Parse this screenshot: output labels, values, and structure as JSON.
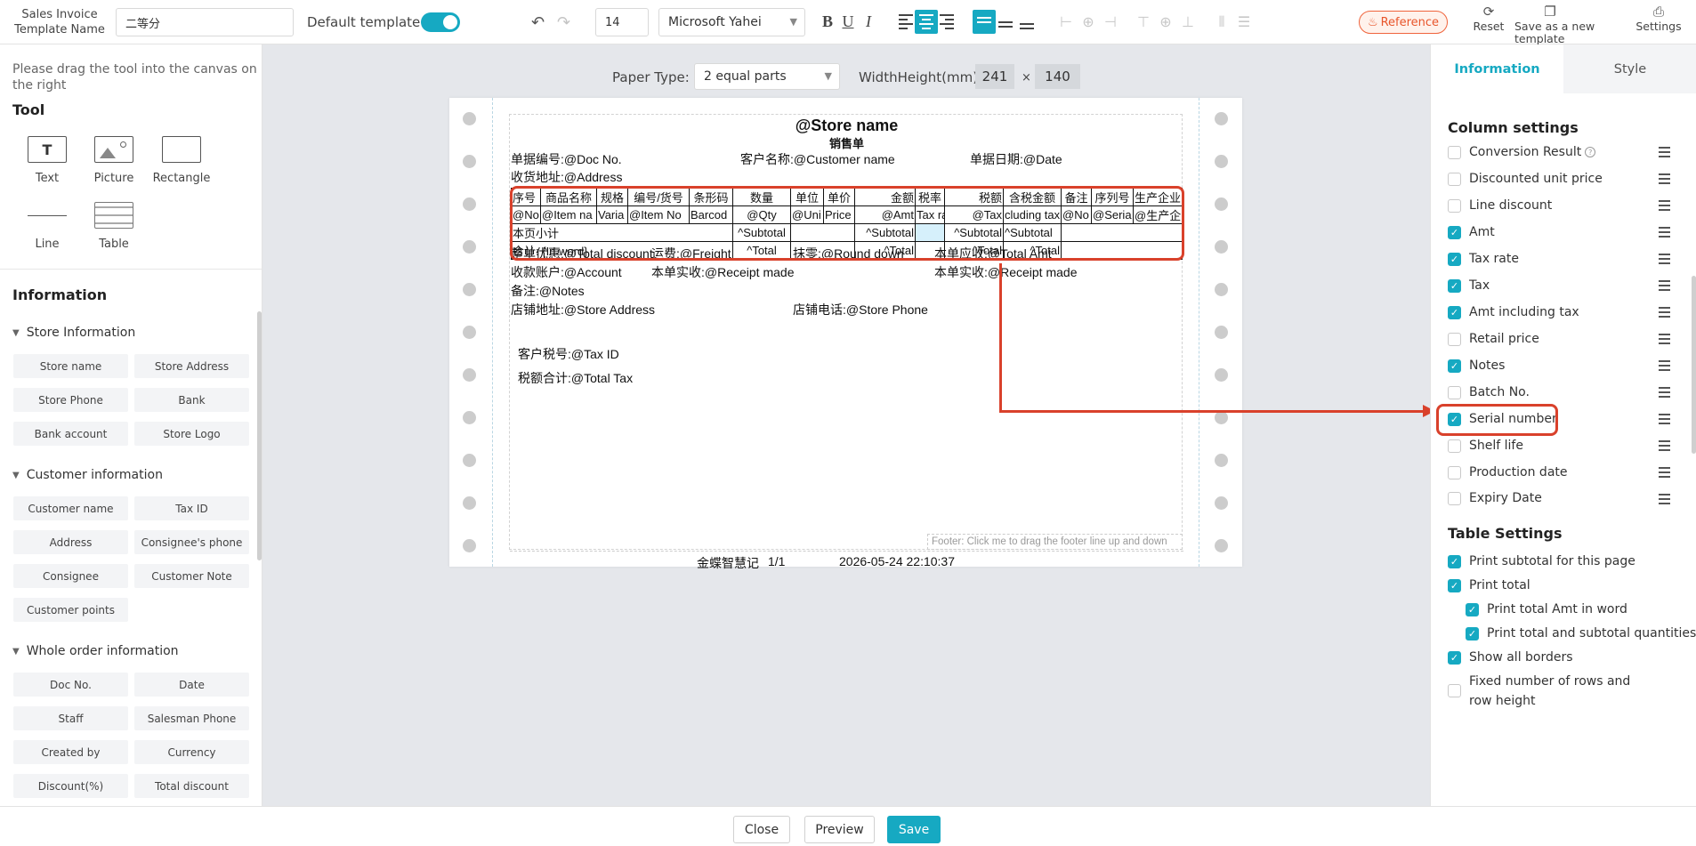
{
  "toolbar": {
    "template_name_label": "Sales Invoice Template Name",
    "template_name_value": "二等分",
    "default_template_label": "Default template",
    "default_template_on": true,
    "font_size": "14",
    "font_family": "Microsoft Yahei",
    "reference_label": "Reference",
    "reset_label": "Reset",
    "save_as_new_label": "Save as a new template",
    "settings_label": "Settings",
    "accent_color": "#16a9c2"
  },
  "left": {
    "hint": "Please drag the tool into the canvas on the right",
    "tool_title": "Tool",
    "tools": [
      {
        "label": "Text",
        "icon": "text-icon"
      },
      {
        "label": "Picture",
        "icon": "picture-icon"
      },
      {
        "label": "Rectangle",
        "icon": "rectangle-icon"
      },
      {
        "label": "Line",
        "icon": "line-icon"
      },
      {
        "label": "Table",
        "icon": "table-icon"
      }
    ],
    "info_title": "Information",
    "groups": [
      {
        "title": "Store Information",
        "fields": [
          "Store name",
          "Store Address",
          "Store Phone",
          "Bank",
          "Bank account",
          "Store Logo"
        ]
      },
      {
        "title": "Customer information",
        "fields": [
          "Customer name",
          "Tax ID",
          "Address",
          "Consignee's phone",
          "Consignee",
          "Customer Note",
          "Customer points"
        ]
      },
      {
        "title": "Whole order information",
        "fields": [
          "Doc No.",
          "Date",
          "Staff",
          "Salesman Phone",
          "Created by",
          "Currency",
          "Discount(%)",
          "Total discount"
        ]
      }
    ]
  },
  "canvas": {
    "paper_type_label": "Paper Type:",
    "paper_type_value": "2 equal parts",
    "width_height_label": "WidthHeight(mm):",
    "width": "241",
    "times": "×",
    "height": "140",
    "store_name": "@Store name",
    "doc_title": "销售单",
    "doc_no": "单据编号:@Doc No.",
    "customer_name": "客户名称:@Customer name",
    "doc_date": "单据日期:@Date",
    "address": "收货地址:@Address",
    "table": {
      "headers": [
        "序号",
        "商品名称",
        "规格",
        "编号/货号",
        "条形码",
        "数量",
        "单位",
        "单价",
        "金额",
        "税率",
        "税额",
        "含税金额",
        "备注",
        "序列号",
        "生产企业"
      ],
      "row": [
        "@No",
        "@Item na",
        "Varia",
        "@Item No",
        "Barcod",
        "@Qty",
        "@Uni",
        "Price",
        "@Amt",
        "Tax ra",
        "@Tax",
        "cluding tax",
        "@No",
        "@Seria",
        "@生产企业"
      ],
      "subtotal_label": "本页小计",
      "subtotal_qty": "^Subtotal",
      "subtotal_amt": "^Subtotal",
      "subtotal_tax": "^Subtotal",
      "subtotal_amt_tax": "^Subtotal",
      "total_label": "合计: {In word}",
      "total_qty": "^Total",
      "total_amt": "^Total",
      "total_tax": "^Total",
      "total_amt_tax": "^Total"
    },
    "total_discount": "整单优惠:@Total discount",
    "freight": "运费:@Freight",
    "round_down": "抹零:@Round down",
    "total_amt_due": "本单应收:@Total Amt",
    "account": "收款账户:@Account",
    "receipt_made": "本单实收:@Receipt made",
    "receipt_made_right": "本单实收:@Receipt made",
    "notes": "备注:@Notes",
    "store_address": "店铺地址:@Store Address",
    "store_phone": "店铺电话:@Store Phone",
    "tax_id": "客户税号:@Tax ID",
    "total_tax": "税额合计:@Total Tax",
    "footer_tip": "Footer: Click me to drag the footer line up and down",
    "footer_brand": "金蝶智慧记",
    "footer_page": "1/1",
    "footer_datetime": "2026-05-24 22:10:37"
  },
  "right": {
    "tab_info": "Information",
    "tab_style": "Style",
    "column_settings_title": "Column settings",
    "columns": [
      {
        "label": "Conversion Result",
        "checked": false,
        "help": true
      },
      {
        "label": "Discounted unit price",
        "checked": false
      },
      {
        "label": "Line discount",
        "checked": false
      },
      {
        "label": "Amt",
        "checked": true
      },
      {
        "label": "Tax rate",
        "checked": true
      },
      {
        "label": "Tax",
        "checked": true
      },
      {
        "label": "Amt including tax",
        "checked": true
      },
      {
        "label": "Retail price",
        "checked": false
      },
      {
        "label": "Notes",
        "checked": true
      },
      {
        "label": "Batch No.",
        "checked": false
      },
      {
        "label": "Serial number",
        "checked": true
      },
      {
        "label": "Shelf life",
        "checked": false
      },
      {
        "label": "Production date",
        "checked": false
      },
      {
        "label": "Expiry Date",
        "checked": false
      }
    ],
    "table_settings_title": "Table Settings",
    "table_settings": [
      {
        "label": "Print subtotal for this page",
        "checked": true,
        "indent": false
      },
      {
        "label": "Print total",
        "checked": true,
        "indent": false
      },
      {
        "label": "Print total Amt in word",
        "checked": true,
        "indent": true
      },
      {
        "label": "Print total and subtotal quantities",
        "checked": true,
        "indent": true
      },
      {
        "label": "Show all borders",
        "checked": true,
        "indent": false
      },
      {
        "label": "Fixed number of rows and row height",
        "checked": false,
        "indent": false
      }
    ]
  },
  "bottom": {
    "close_label": "Close",
    "preview_label": "Preview",
    "save_label": "Save"
  }
}
